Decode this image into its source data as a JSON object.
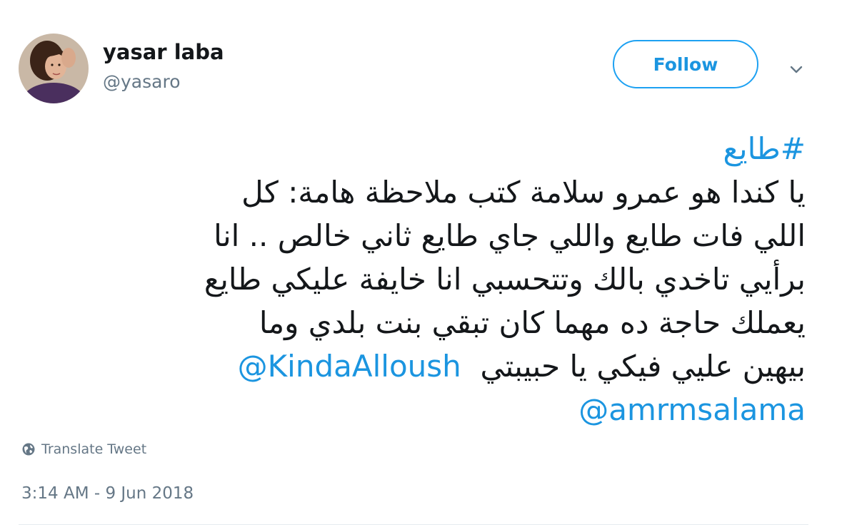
{
  "author": {
    "display_name": "yasar laba",
    "handle": "@yasaro"
  },
  "actions": {
    "follow_label": "Follow",
    "more_icon": "chevron-down-icon"
  },
  "tweet": {
    "hashtag": "#طايع",
    "lines": [
      "يا كندا هو عمرو سلامة كتب ملاحظة هامة: كل",
      "اللي فات طايع واللي جاي طايع ثاني خالص .. انا",
      "برأيي تاخدي بالك وتتحسبي انا خايفة عليكي طايع",
      "يعملك حاجة ده مهما كان تبقي بنت بلدي وما"
    ],
    "last_line_text": "بيهين عليي فيكي يا حبيبتي",
    "mentions": [
      "@KindaAlloush",
      "@amrmsalama"
    ]
  },
  "translate": {
    "label": "Translate Tweet",
    "icon": "globe-icon"
  },
  "timestamp": "3:14 AM - 9 Jun 2018",
  "colors": {
    "link": "#1b95e0",
    "follow_border": "#1da1f2",
    "secondary_text": "#657786",
    "primary_text": "#14171a"
  }
}
